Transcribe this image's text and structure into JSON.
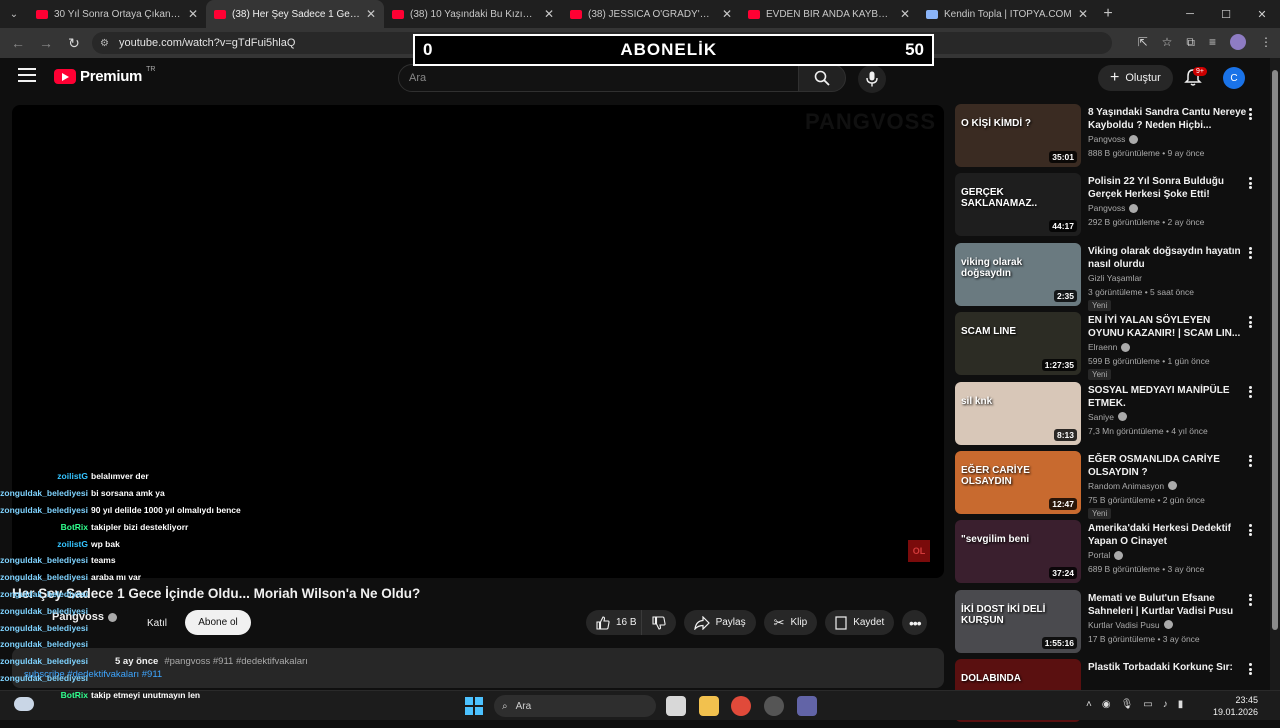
{
  "browser": {
    "tabs": [
      {
        "title": "30 Yıl Sonra Ortaya Çıkan Gerçe",
        "type": "youtube"
      },
      {
        "title": "(38) Her Şey Sadece 1 Gece İçin",
        "type": "youtube"
      },
      {
        "title": "(38) 10 Yaşındaki Bu Kızın Cesa",
        "type": "youtube"
      },
      {
        "title": "(38) JESSICA O'GRADY'NİN ARI",
        "type": "youtube"
      },
      {
        "title": "EVDEN BİR ANDA KAYBOLDU /",
        "type": "youtube"
      },
      {
        "title": "Kendin Topla | İTOPYA.COM",
        "type": "other"
      }
    ],
    "active_tab": 1,
    "url": "youtube.com/watch?v=gTdFui5hlaQ"
  },
  "overlay": {
    "left_value": "0",
    "label": "ABONELİK",
    "right_value": "50"
  },
  "header": {
    "logo_text": "Premium",
    "logo_country": "TR",
    "search_placeholder": "Ara",
    "create_label": "Oluştur",
    "notification_badge": "9+",
    "avatar_letter": "C"
  },
  "player": {
    "watermark": "PANGVOSS",
    "badge": "OL"
  },
  "chat": [
    {
      "user": "zoilistG",
      "message": "belalımver der",
      "kind": "g"
    },
    {
      "user": "zonguldak_belediyesi",
      "message": "bi sorsana amk ya",
      "kind": "u"
    },
    {
      "user": "zonguldak_belediyesi",
      "message": "90 yıl delilde 1000 yıl olmalıydı bence",
      "kind": "u"
    },
    {
      "user": "BotRix",
      "message": "takipler bizi destekliyorr",
      "kind": "bot"
    },
    {
      "user": "zoilistG",
      "message": "wp bak",
      "kind": "g"
    },
    {
      "user": "zonguldak_belediyesi",
      "message": "teams",
      "kind": "u"
    },
    {
      "user": "zonguldak_belediyesi",
      "message": "araba mı var",
      "kind": "u"
    },
    {
      "user": "zonguldak_belediyesi",
      "message": "",
      "kind": "u"
    },
    {
      "user": "zonguldak_belediyesi",
      "message": "",
      "kind": "u"
    },
    {
      "user": "zonguldak_belediyesi",
      "message": "",
      "kind": "u"
    },
    {
      "user": "zonguldak_belediyesi",
      "message": "",
      "kind": "u"
    },
    {
      "user": "zonguldak_belediyesi",
      "message": "",
      "kind": "u"
    },
    {
      "user": "zonguldak_belediyesi",
      "message": "",
      "kind": "u"
    },
    {
      "user": "BotRix",
      "message": "takip etmeyi unutmayın len",
      "kind": "bot"
    }
  ],
  "video": {
    "title": "Her Şey Sadece 1 Gece İçinde Oldu... Moriah Wilson'a Ne Oldu?",
    "channel": "Pangvoss",
    "join_label": "Katıl",
    "subscribe_label": "Abone ol",
    "likes": "16 B",
    "share_label": "Paylaş",
    "clip_label": "Klip",
    "save_label": "Kaydet",
    "date": "5 ay önce",
    "tags": "#pangvoss #911 #dedektifvakaları",
    "desc_line": "subscribe #dedektifvakaları #911"
  },
  "recommendations": [
    {
      "title": "8 Yaşındaki Sandra Cantu Nereye Kayboldu ? Neden Hiçbi...",
      "channel": "Pangvoss",
      "verified": true,
      "stats": "888 B görüntüleme • 9 ay önce",
      "duration": "35:01",
      "thumb_text": "O KİŞİ KİMDİ ?",
      "thumb_color": "#3a2b22",
      "new": false
    },
    {
      "title": "Polisin 22 Yıl Sonra Bulduğu Gerçek Herkesi Şoke Etti!",
      "channel": "Pangvoss",
      "verified": true,
      "stats": "292 B görüntüleme • 2 ay önce",
      "duration": "44:17",
      "thumb_text": "GERÇEK SAKLANAMAZ..",
      "thumb_color": "#1e1e1e",
      "new": false
    },
    {
      "title": "Viking olarak doğsaydın hayatın nasıl olurdu",
      "channel": "Gizli Yaşamlar",
      "verified": false,
      "stats": "3 görüntüleme • 5 saat önce",
      "duration": "2:35",
      "thumb_text": "viking olarak doğsaydın",
      "thumb_color": "#6a7a80",
      "new": true
    },
    {
      "title": "EN İYİ YALAN SÖYLEYEN OYUNU KAZANIR! | SCAM LIN...",
      "channel": "Elraenn",
      "verified": true,
      "stats": "599 B görüntüleme • 1 gün önce",
      "duration": "1:27:35",
      "thumb_text": "SCAM LINE",
      "thumb_color": "#2c2c24",
      "new": true
    },
    {
      "title": "SOSYAL MEDYAYI MANİPÜLE ETMEK.",
      "channel": "Saniye",
      "verified": true,
      "stats": "7,3 Mn görüntüleme • 4 yıl önce",
      "duration": "8:13",
      "thumb_text": "sil knk",
      "thumb_color": "#d8c7b8",
      "new": false
    },
    {
      "title": "EĞER OSMANLIDA CARİYE OLSAYDIN ?",
      "channel": "Random Animasyon",
      "verified": true,
      "stats": "75 B görüntüleme • 2 gün önce",
      "duration": "12:47",
      "thumb_text": "EĞER CARİYE OLSAYDIN",
      "thumb_color": "#c86a2f",
      "new": true
    },
    {
      "title": "Amerika'daki Herkesi Dedektif Yapan O Cinayet",
      "channel": "Portal",
      "verified": true,
      "stats": "689 B görüntüleme • 3 ay önce",
      "duration": "37:24",
      "thumb_text": "\"sevgilim beni",
      "thumb_color": "#3a1f2e",
      "new": false
    },
    {
      "title": "Memati ve Bulut'un Efsane Sahneleri | Kurtlar Vadisi Pusu",
      "channel": "Kurtlar Vadisi Pusu",
      "verified": true,
      "stats": "17 B görüntüleme • 3 ay önce",
      "duration": "1:55:16",
      "thumb_text": "İKİ DOST İKİ DELİ KURŞUN",
      "thumb_color": "#4a4a4e",
      "new": false
    },
    {
      "title": "Plastik Torbadaki Korkunç Sır:",
      "channel": "",
      "verified": false,
      "stats": "",
      "duration": "",
      "thumb_text": "DOLABINDA",
      "thumb_color": "#5a1010",
      "new": false
    }
  ],
  "new_label": "Yeni",
  "taskbar": {
    "search_label": "Ara",
    "time": "23:45",
    "date": "19.01.2026"
  }
}
